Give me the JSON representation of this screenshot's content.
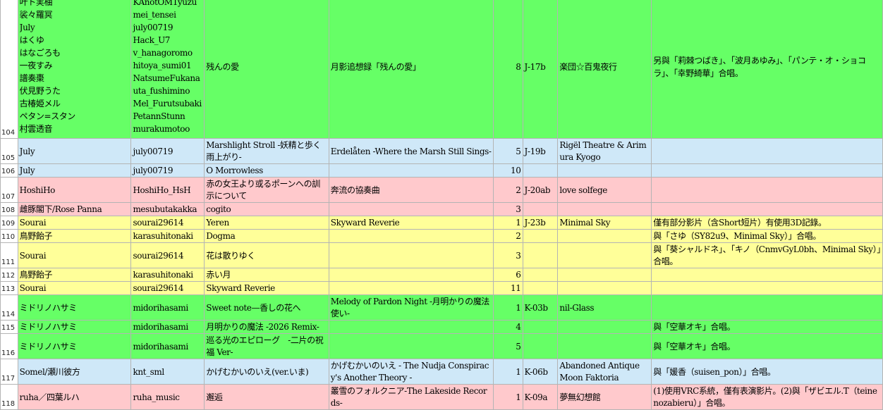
{
  "colors": {
    "green": "#66ff66",
    "blue": "#cfe8f8",
    "pink": "#ffc9cc",
    "yellow": "#ffff99"
  },
  "rows": [
    {
      "num": "104",
      "authors": [
        "叶ト実柚",
        "裟々羅冥",
        "July",
        "はくゆ",
        "はなごろも",
        "一夜すみ",
        "譜奏棗",
        "伏見野うた",
        "古椿姫メル",
        "ペタン=スタン",
        "村雲透音"
      ],
      "ids": [
        "KAnotOM1yuzu",
        "mei_tensei",
        "july00719",
        "Hack_U7",
        "v_hanagoromo",
        "hitoya_sumi01",
        "NatsumeFukana",
        "uta_fushimino",
        "Mel_Furutsubaki",
        "PetannStunn",
        "murakumotoo"
      ],
      "song": "残んの愛",
      "album": "月影追想録「残んの愛」",
      "count": "8",
      "booth": "J-17b",
      "circle": "楽団☆百鬼夜行",
      "note": "另與「莉棘つばき」、「波月あゆみ」、「パンテ・オ・ショコラ」、「幸野綺華」合唱。"
    },
    {
      "num": "105",
      "author": "July",
      "id": "july00719",
      "song": "Marshlight Stroll -妖精と歩く雨上がり-",
      "album": "Erdelåten -Where the Marsh Still Sings-",
      "count": "5",
      "booth": "J-19b",
      "circle": "Rigël Theatre & Arimura Kyogo",
      "note": ""
    },
    {
      "num": "106",
      "author": "July",
      "id": "july00719",
      "song": "O Morrowless",
      "album": "",
      "count": "10",
      "booth": "",
      "circle": "",
      "note": ""
    },
    {
      "num": "107",
      "author": "HoshiHo",
      "id": "HoshiHo_HsH",
      "song": "赤の女王より或るポーンへの訓示について",
      "album": "奔流の協奏曲",
      "count": "2",
      "booth": "J-20ab",
      "circle": "love solfege",
      "note": ""
    },
    {
      "num": "108",
      "author": "雌豚閣下/Rose Panna",
      "id": "mesubutakakka",
      "song": "cogito",
      "album": "",
      "count": "3",
      "booth": "",
      "circle": "",
      "note": ""
    },
    {
      "num": "109",
      "author": "Sourai",
      "id": "sourai29614",
      "song": "Yeren",
      "album": "Skyward Reverie",
      "count": "1",
      "booth": "J-23b",
      "circle": "Minimal Sky",
      "note": "僅有部分影片（含Short短片）有使用3D記錄。"
    },
    {
      "num": "110",
      "author": "鳥野飴子",
      "id": "karasuhitonaki",
      "song": "Dogma",
      "album": "",
      "count": "2",
      "booth": "",
      "circle": "",
      "note": "與「さゆ（SY82u9、Minimal Sky）」合唱。"
    },
    {
      "num": "111",
      "author": "Sourai",
      "id": "sourai29614",
      "song": "花は散りゆく",
      "album": "",
      "count": "3",
      "booth": "",
      "circle": "",
      "note": "與「葵シャルドネ」、「キノ（CnmvGyL0bh、Minimal Sky）」合唱。"
    },
    {
      "num": "112",
      "author": "鳥野飴子",
      "id": "karasuhitonaki",
      "song": "赤い月",
      "album": "",
      "count": "6",
      "booth": "",
      "circle": "",
      "note": ""
    },
    {
      "num": "113",
      "author": "Sourai",
      "id": "sourai29614",
      "song": "Skyward Reverie",
      "album": "",
      "count": "11",
      "booth": "",
      "circle": "",
      "note": ""
    },
    {
      "num": "114",
      "author": "ミドリノハサミ",
      "id": "midorihasami",
      "song": "Sweet note—香しの花へ",
      "album": "Melody of Pardon Night -月明かりの魔法使い-",
      "count": "1",
      "booth": "K-03b",
      "circle": "nil-Glass",
      "note": ""
    },
    {
      "num": "115",
      "author": "ミドリノハサミ",
      "id": "midorihasami",
      "song": "月明かりの魔法 -2026 Remix-",
      "album": "",
      "count": "4",
      "booth": "",
      "circle": "",
      "note": "與「空華オキ」合唱。"
    },
    {
      "num": "116",
      "author": "ミドリノハサミ",
      "id": "midorihasami",
      "song": "巡る光のエピローグ　-二片の祝福 Ver-",
      "album": "",
      "count": "5",
      "booth": "",
      "circle": "",
      "note": "與「空華オキ」合唱。"
    },
    {
      "num": "117",
      "author": "Somel/瀬川彼方",
      "id": "knt_sml",
      "song": "かげむかいのいえ(ver.いま)",
      "album": "かげむかいのいえ - The Nudja Conspiracy's Another Theory -",
      "count": "1",
      "booth": "K-06b",
      "circle": "Abandoned Antique Moon Faktoria",
      "note": "與「媛香（suisen_pon）」合唱。"
    },
    {
      "num": "118",
      "author": "ruha／四葉ルハ",
      "id": "ruha_music",
      "song": "邂逅",
      "album": "叢雪のフォルクニア-The Lakeside Records-",
      "count": "1",
      "booth": "K-09a",
      "circle": "夢無幻想館",
      "note": "(1)使用VRC系統，僅有表演影片。(2)與「ザビエル.T（teinenozabieru）」合唱。"
    }
  ]
}
